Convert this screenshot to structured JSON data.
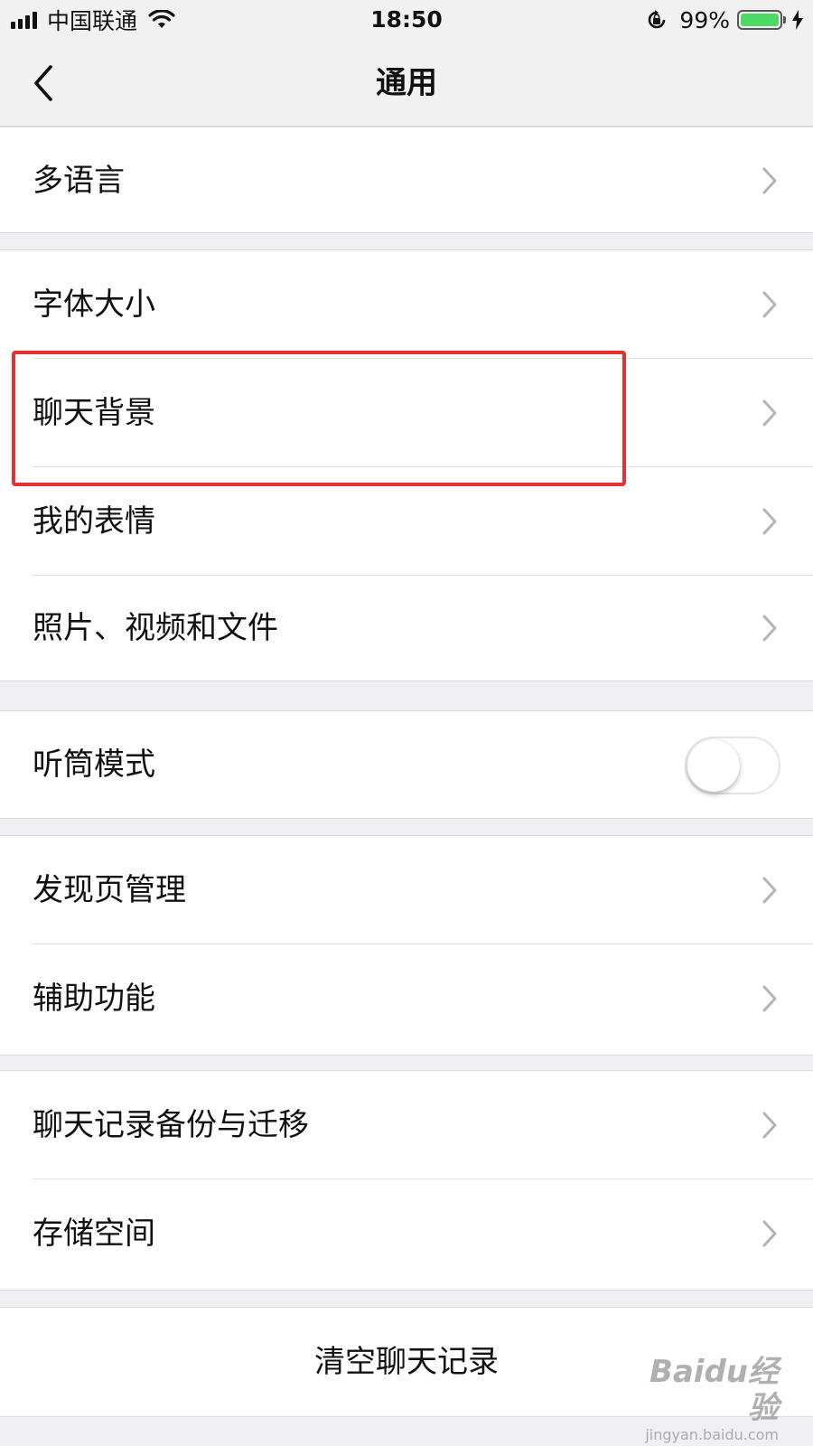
{
  "status_bar": {
    "carrier": "中国联通",
    "time": "18:50",
    "battery_percent": "99%",
    "battery_level": 0.99,
    "icons": [
      "signal-icon",
      "wifi-icon",
      "rotation-lock-icon",
      "battery-icon",
      "charging-icon"
    ]
  },
  "nav": {
    "title": "通用",
    "back_icon": "chevron-left-icon"
  },
  "groups": {
    "language": {
      "label": "多语言"
    },
    "display": {
      "font_size": "字体大小",
      "chat_background": "聊天背景",
      "my_stickers": "我的表情",
      "media_files": "照片、视频和文件"
    },
    "earpiece": {
      "label": "听筒模式",
      "enabled": false
    },
    "discover": {
      "discover_manage": "发现页管理",
      "accessibility": "辅助功能"
    },
    "storage": {
      "chat_backup": "聊天记录备份与迁移",
      "storage_space": "存储空间"
    },
    "clear": {
      "label": "清空聊天记录"
    }
  },
  "highlight_color": "#e8312f",
  "watermark": {
    "logo": "Baidu经验",
    "url": "jingyan.baidu.com"
  }
}
